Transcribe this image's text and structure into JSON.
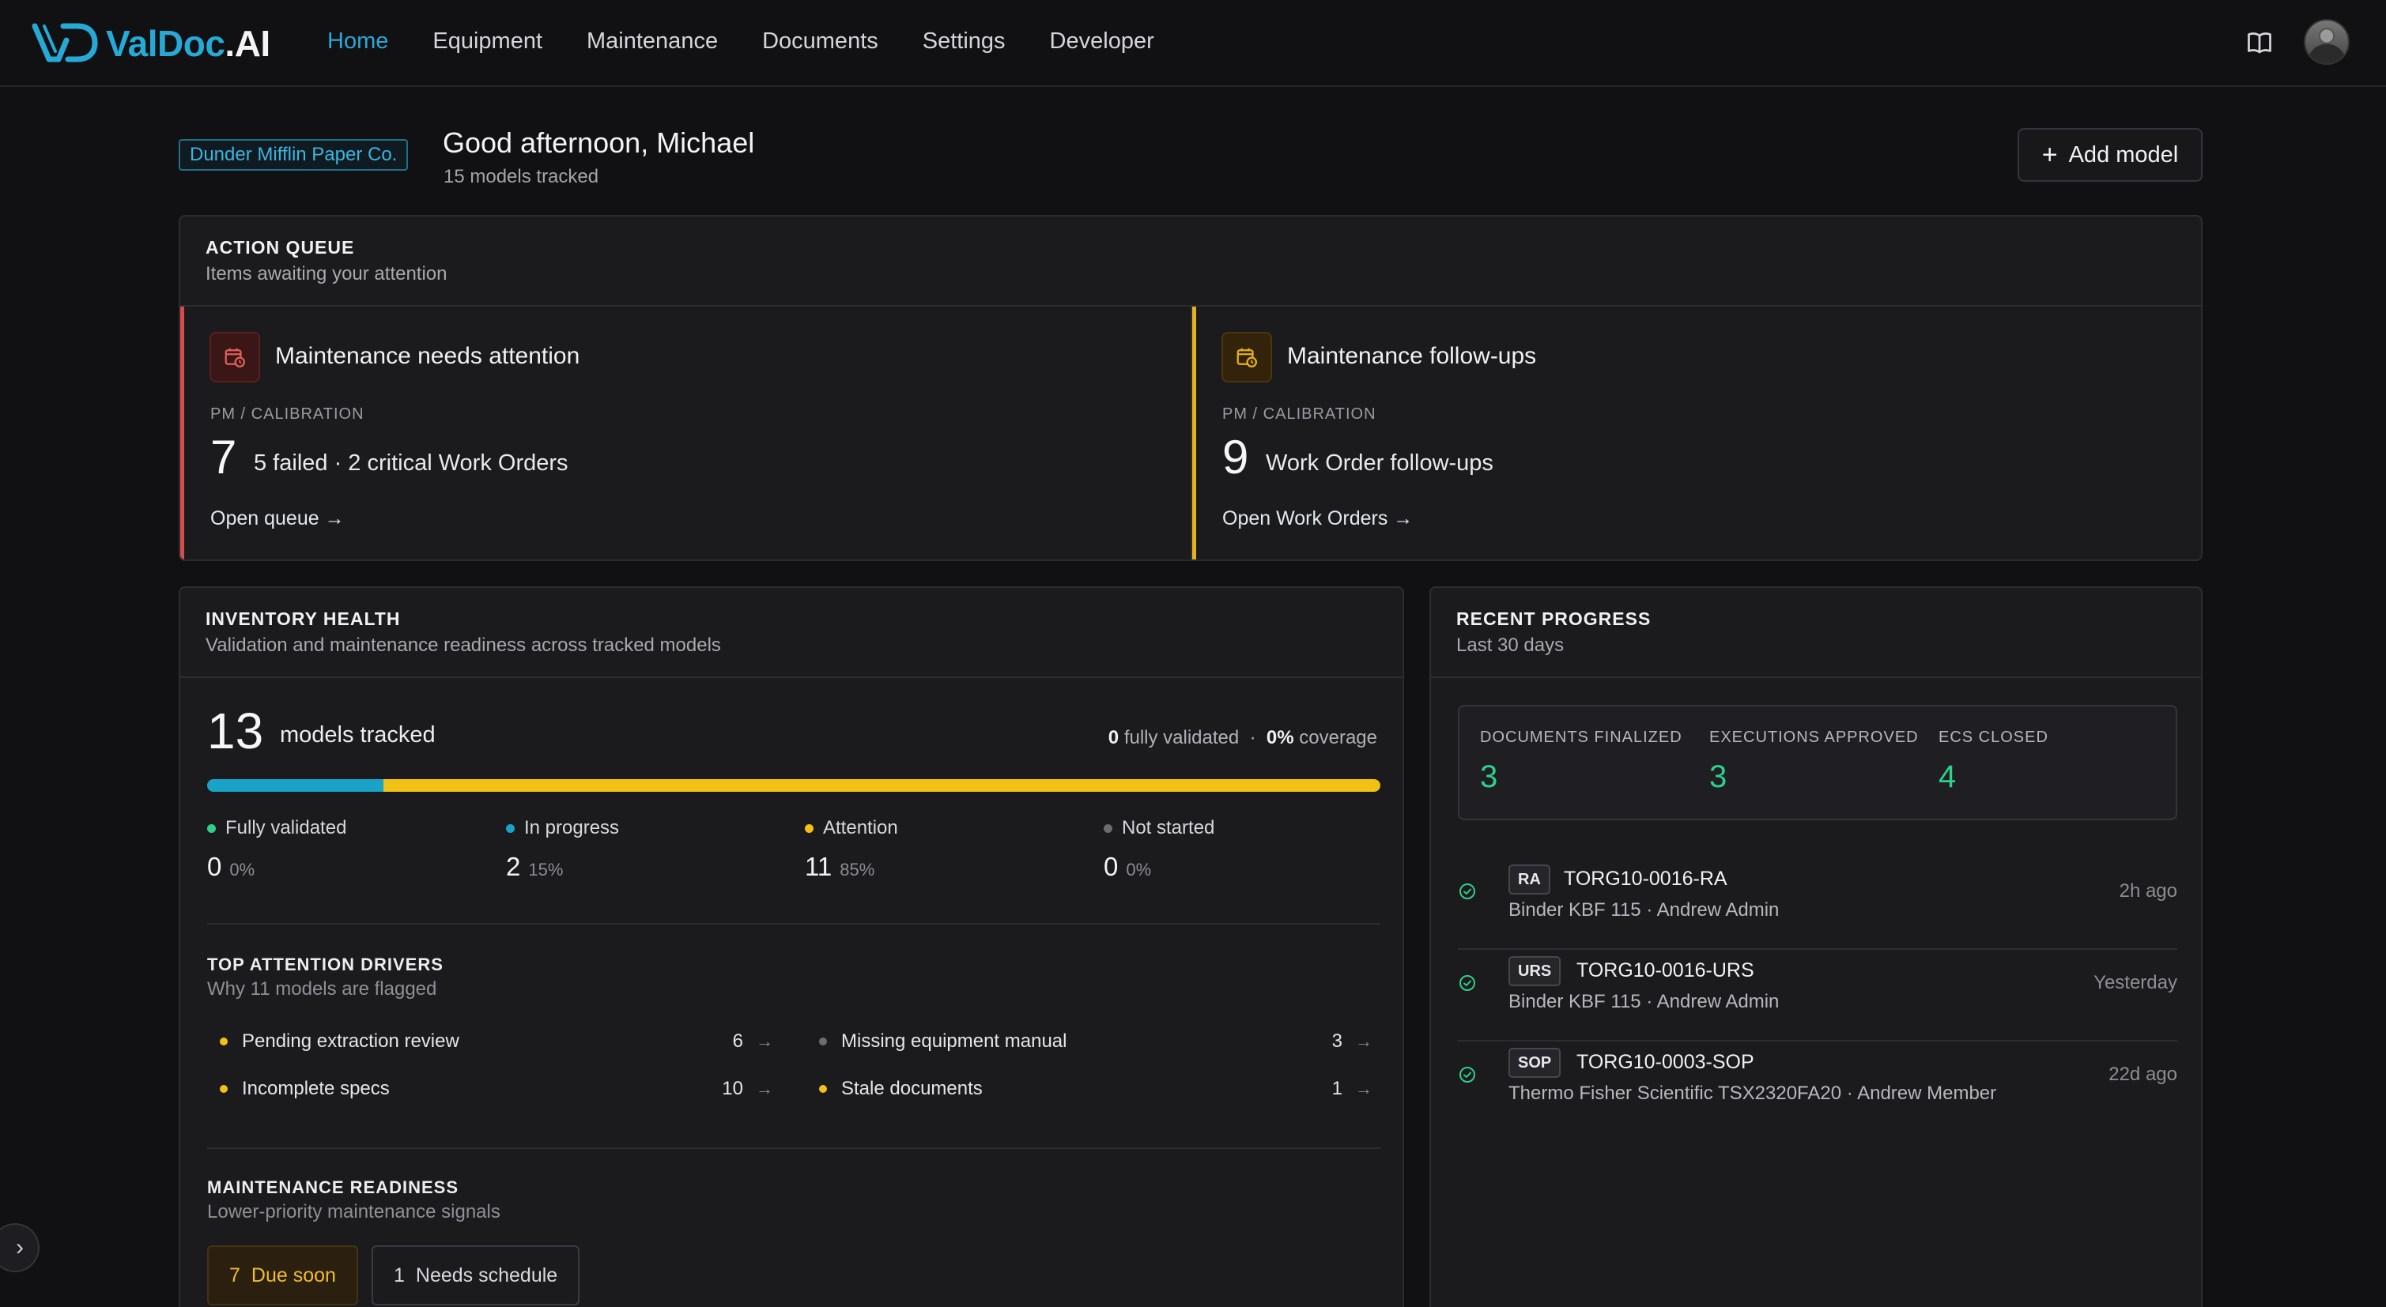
{
  "brand": {
    "name_part1": "ValDoc",
    "name_part2": ".AI"
  },
  "nav": {
    "items": [
      {
        "label": "Home",
        "active": true
      },
      {
        "label": "Equipment"
      },
      {
        "label": "Maintenance"
      },
      {
        "label": "Documents"
      },
      {
        "label": "Settings"
      },
      {
        "label": "Developer"
      }
    ]
  },
  "header": {
    "org": "Dunder Mifflin Paper Co.",
    "greeting": "Good afternoon, Michael",
    "subtitle": "15 models tracked",
    "add_button": "Add model"
  },
  "action_queue": {
    "title": "ACTION QUEUE",
    "subtitle": "Items awaiting your attention",
    "cards": [
      {
        "title": "Maintenance needs attention",
        "kicker": "PM / CALIBRATION",
        "count": "7",
        "description": "5 failed · 2 critical Work Orders",
        "link": "Open queue",
        "accent": "#d94c4c"
      },
      {
        "title": "Maintenance follow-ups",
        "kicker": "PM / CALIBRATION",
        "count": "9",
        "description": "Work Order follow-ups",
        "link": "Open Work Orders",
        "accent": "#e7b11c"
      }
    ]
  },
  "inventory": {
    "title": "INVENTORY HEALTH",
    "subtitle": "Validation and maintenance readiness across tracked models",
    "count": "13",
    "count_label": "models tracked",
    "fully_validated_count": "0",
    "fully_validated_text": "fully validated",
    "coverage_value": "0%",
    "coverage_text": "coverage",
    "bar_segments": [
      {
        "name": "Fully validated",
        "fraction": 0.0,
        "color": "#2fcf8a"
      },
      {
        "name": "In progress",
        "fraction": 0.15,
        "color": "#1aa3c9"
      },
      {
        "name": "Attention",
        "fraction": 0.85,
        "color": "#f2c116"
      },
      {
        "name": "Not started",
        "fraction": 0.0,
        "color": "#6b6b72"
      }
    ],
    "stats": [
      {
        "label": "Fully validated",
        "value": "0",
        "pct": "0%",
        "color": "#2fcf8a"
      },
      {
        "label": "In progress",
        "value": "2",
        "pct": "15%",
        "color": "#1aa3c9"
      },
      {
        "label": "Attention",
        "value": "11",
        "pct": "85%",
        "color": "#f2c116"
      },
      {
        "label": "Not started",
        "value": "0",
        "pct": "0%",
        "color": "#6b6b72"
      }
    ],
    "drivers_title": "TOP ATTENTION DRIVERS",
    "drivers_subtitle": "Why 11 models are flagged",
    "drivers": [
      {
        "label": "Pending extraction review",
        "count": "6",
        "color": "#f2c116"
      },
      {
        "label": "Missing equipment manual",
        "count": "3",
        "color": "#6b6b72"
      },
      {
        "label": "Incomplete specs",
        "count": "10",
        "color": "#f2c116"
      },
      {
        "label": "Stale documents",
        "count": "1",
        "color": "#f2c116"
      }
    ],
    "maint_title": "MAINTENANCE READINESS",
    "maint_subtitle": "Lower-priority maintenance signals",
    "chips": [
      {
        "count": "7",
        "label": "Due soon"
      },
      {
        "count": "1",
        "label": "Needs schedule"
      }
    ]
  },
  "recent": {
    "title": "RECENT PROGRESS",
    "subtitle": "Last 30 days",
    "stats": [
      {
        "label": "DOCUMENTS FINALIZED",
        "value": "3"
      },
      {
        "label": "EXECUTIONS APPROVED",
        "value": "3"
      },
      {
        "label": "ECS CLOSED",
        "value": "4"
      }
    ],
    "items": [
      {
        "tag": "RA",
        "name": "TORG10-0016-RA",
        "meta": "Binder KBF 115 · Andrew Admin",
        "when": "2h ago"
      },
      {
        "tag": "URS",
        "name": "TORG10-0016-URS",
        "meta": "Binder KBF 115 · Andrew Admin",
        "when": "Yesterday"
      },
      {
        "tag": "SOP",
        "name": "TORG10-0003-SOP",
        "meta": "Thermo Fisher Scientific TSX2320FA20 · Andrew Member",
        "when": "22d ago"
      }
    ]
  }
}
